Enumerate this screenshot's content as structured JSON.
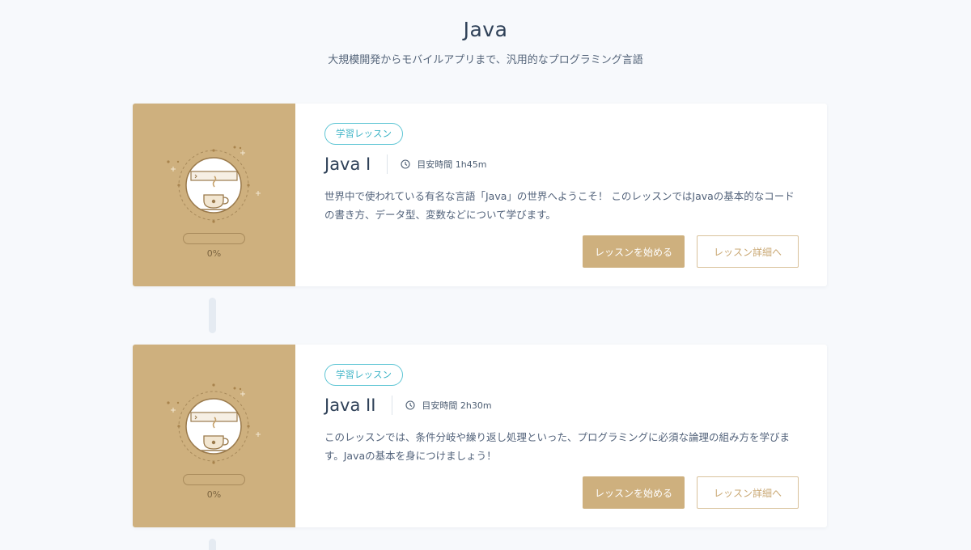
{
  "header": {
    "title": "Java",
    "subtitle": "大規模開発からモバイルアプリまで、汎用的なプログラミング言語"
  },
  "colors": {
    "background": "#f7f9fc",
    "thumb": "#ceb07e",
    "badge": "#3fb4c6",
    "primary_button": "#ceb07e"
  },
  "lessons": [
    {
      "badge": "学習レッスン",
      "title": "Java I",
      "time_label": "目安時間 1h45m",
      "description": "世界中で使われている有名な言語「Java」の世界へようこそ！ このレッスンではJavaの基本的なコードの書き方、データ型、変数などについて学びます。",
      "progress": 0,
      "progress_label": "0%",
      "start_button": "レッスンを始める",
      "detail_button": "レッスン詳細へ",
      "icon": "coffee-cup-icon"
    },
    {
      "badge": "学習レッスン",
      "title": "Java II",
      "time_label": "目安時間 2h30m",
      "description": "このレッスンでは、条件分岐や繰り返し処理といった、プログラミングに必須な論理の組み方を学びます。Javaの基本を身につけましょう！",
      "progress": 0,
      "progress_label": "0%",
      "start_button": "レッスンを始める",
      "detail_button": "レッスン詳細へ",
      "icon": "coffee-cup-icon"
    }
  ]
}
